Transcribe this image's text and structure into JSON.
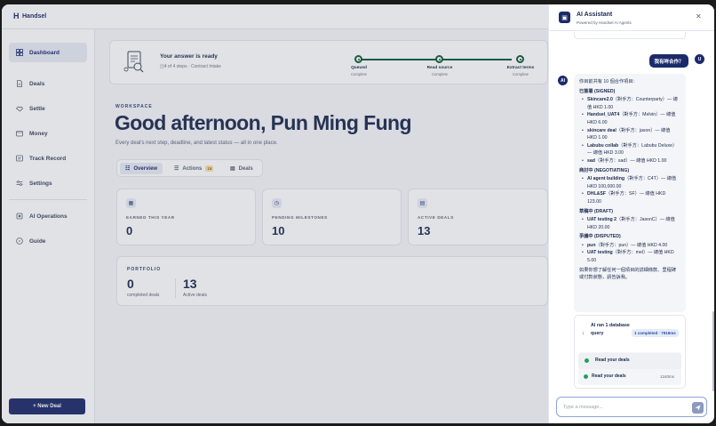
{
  "app": {
    "brand": "Handsel"
  },
  "sidebar": {
    "items": [
      {
        "label": "Dashboard",
        "icon": "grid-icon"
      },
      {
        "label": "Deals",
        "icon": "document-icon"
      },
      {
        "label": "Settle",
        "icon": "handshake-icon"
      },
      {
        "label": "Money",
        "icon": "wallet-icon"
      },
      {
        "label": "Track Record",
        "icon": "receipt-icon"
      },
      {
        "label": "Settings",
        "icon": "sliders-icon"
      },
      {
        "label": "AI Operations",
        "icon": "ai-chip-icon"
      },
      {
        "label": "Guide",
        "icon": "help-circle-icon"
      }
    ],
    "new_deal_label": "+ New Deal"
  },
  "answer_card": {
    "title": "Your answer is ready",
    "subtitle": "4 of 4 steps · Contract Intake",
    "steps": [
      {
        "label": "Queued",
        "status": "Complete"
      },
      {
        "label": "Read source",
        "status": "Complete"
      },
      {
        "label": "Extract terms",
        "status": "Complete"
      }
    ]
  },
  "workspace": {
    "label": "WORKSPACE",
    "greeting": "Good afternoon, Pun Ming Fung",
    "subtitle": "Every deal's next step, deadline, and latest status — all in one place."
  },
  "tabs": [
    {
      "label": "Overview"
    },
    {
      "label": "Actions",
      "badge": "16"
    },
    {
      "label": "Deals"
    }
  ],
  "stats": [
    {
      "label": "EARNED THIS YEAR",
      "value": "0"
    },
    {
      "label": "PENDING MILESTONES",
      "value": "10"
    },
    {
      "label": "ACTIVE DEALS",
      "value": "13"
    }
  ],
  "portfolio": {
    "label": "PORTFOLIO",
    "completed_value": "0",
    "completed_caption": "completed deals",
    "active_value": "13",
    "active_caption": "Active deals"
  },
  "chat": {
    "title": "AI Assistant",
    "subtitle": "Powered by Handsel AI Agents",
    "user_message": "我有咩合作？",
    "user_initial": "U",
    "ai_initial": "AI",
    "ai_reply": {
      "intro": "你目前共有 10 個合作項目：",
      "groups": [
        {
          "heading": "已簽署 (SIGNED)",
          "items": [
            {
              "name": "Skincare2.0",
              "rest": "（對手方：Counterparty）— 總值 HKD 1.00"
            },
            {
              "name": "Handsel_UAT4",
              "rest": "（對手方：Melvin）— 總值 HKD 6.00"
            },
            {
              "name": "skincare deal",
              "rest": "（對手方：jason）— 總值 HKD 1.00"
            },
            {
              "name": "Labubu collab",
              "rest": "（對手方：Labubu Deluxe）— 總值 HKD 3.00"
            },
            {
              "name": "sad",
              "rest": "（對手方：sad）— 總值 HKD 1.00"
            }
          ]
        },
        {
          "heading": "商討中 (NEGOTIATING)",
          "items": [
            {
              "name": "AI agent building",
              "rest": "（對手方：C4T）— 總值 HKD 100,000.00"
            },
            {
              "name": "DHL&SF",
              "rest": "（對手方：SF）— 總值 HKD 123.00"
            }
          ]
        },
        {
          "heading": "草稿中 (DRAFT)",
          "items": [
            {
              "name": "UAT testing 2",
              "rest": "（對手方：JasonC）— 總值 HKD 20.00"
            }
          ]
        },
        {
          "heading": "爭議中 (DISPUTED)",
          "items": [
            {
              "name": "pun",
              "rest": "（對手方：pun）— 總值 HKD 4.00"
            },
            {
              "name": "UAT testing",
              "rest": "（對手方：mel）— 總值 HKD 5.00"
            }
          ]
        }
      ],
      "outro": "如果你想了解任何一個項目的詳細條款、里程碑或付款狀態，請告訴我。"
    },
    "tool": {
      "title": "AI ran 1 database query",
      "badge": "1 completed · 7916ms",
      "step_header": "Read your deals",
      "step_name": "Read your deals",
      "step_ms": "1240ms"
    },
    "input_placeholder": "Type a message...",
    "input_value": ""
  }
}
